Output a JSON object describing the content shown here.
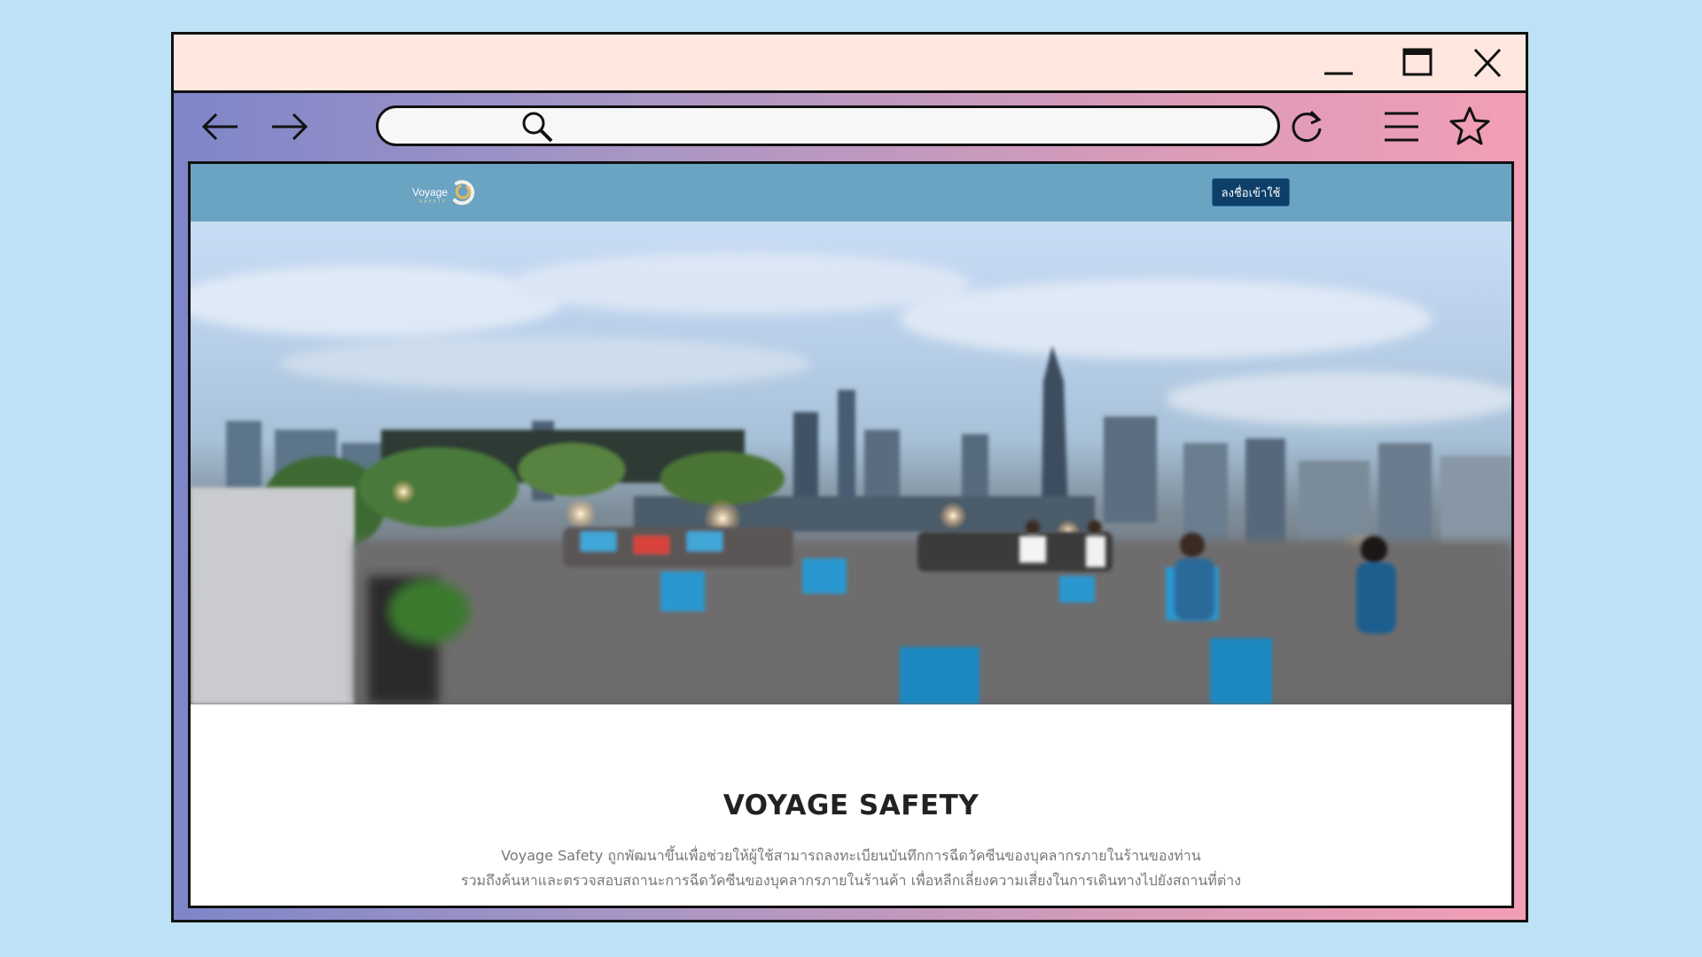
{
  "browser": {
    "address_value": "",
    "icons": {
      "back": "arrow-left-icon",
      "forward": "arrow-right-icon",
      "search": "magnifier-icon",
      "reload": "reload-icon",
      "menu": "hamburger-icon",
      "bookmark": "star-icon",
      "minimize": "minimize-icon",
      "maximize": "maximize-icon",
      "close": "close-icon"
    }
  },
  "site": {
    "logo_text": "Voyage",
    "logo_sub": "SAFETY",
    "login_label": "ลงชื่อเข้าใช้",
    "title": "VOYAGE SAFETY",
    "description_line1": "Voyage Safety ถูกพัฒนาขึ้นเพื่อช่วยให้ผู้ใช้สามารถลงทะเบียนบันทึกการฉีดวัคซีนของบุคลากรภายในร้านของท่าน",
    "description_line2": "รวมถึงค้นหาและตรวจสอบสถานะการฉีดวัคซีนของบุคลากรภายในร้านค้า เพื่อหลีกเลี่ยงความเสี่ยงในการเดินทางไปยังสถานที่ต่าง"
  },
  "colors": {
    "page_bg": "#bde2f5",
    "titlebar_bg": "#fde7de",
    "site_header": "#6ba3c2",
    "login_button": "#0d3f68"
  }
}
